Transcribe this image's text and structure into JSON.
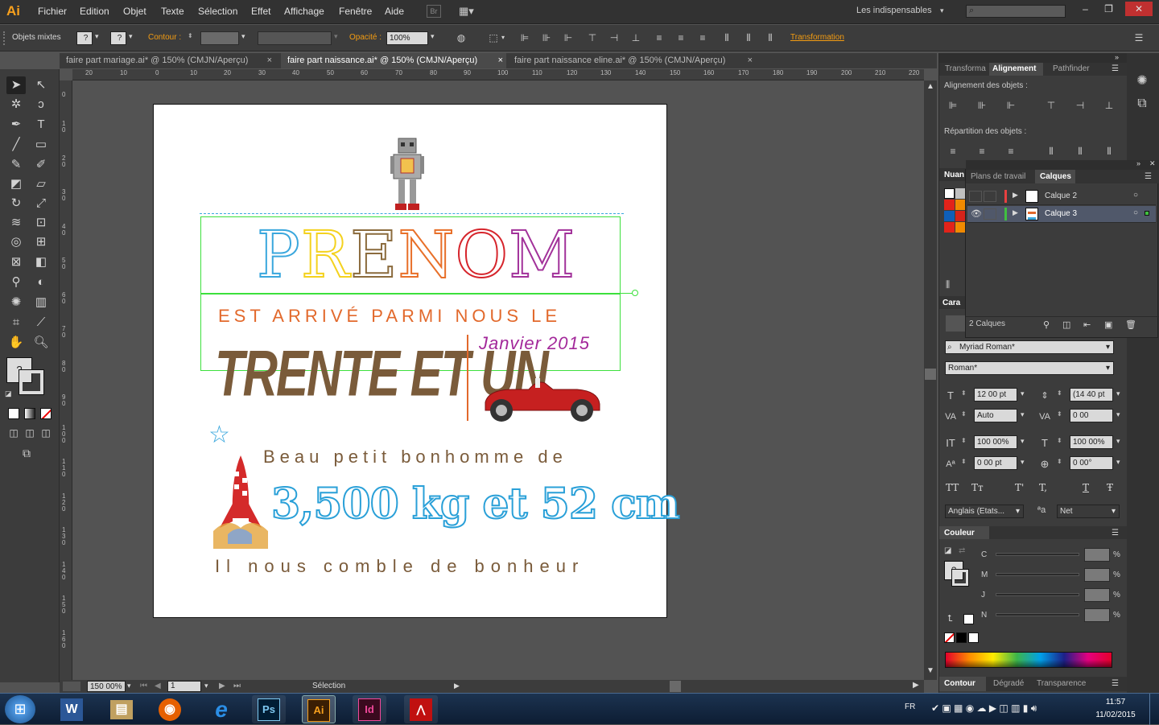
{
  "app": {
    "logo": "Ai"
  },
  "menu": [
    "Fichier",
    "Edition",
    "Objet",
    "Texte",
    "Sélection",
    "Effet",
    "Affichage",
    "Fenêtre",
    "Aide"
  ],
  "menu_br": "Br",
  "workspace": "Les indispensables",
  "control": {
    "selection_label": "Objets mixtes",
    "contour_label": "Contour :",
    "opacity_label": "Opacité :",
    "opacity_value": "100%",
    "transform_label": "Transformation",
    "question_mark": "?"
  },
  "tabs": [
    {
      "label": "faire part mariage.ai* @ 150% (CMJN/Aperçu)"
    },
    {
      "label": "faire part naissance.ai* @ 150% (CMJN/Aperçu)"
    },
    {
      "label": "faire part naissance eline.ai* @ 150% (CMJN/Aperçu)"
    }
  ],
  "ruler_h": [
    "20",
    "10",
    "0",
    "10",
    "20",
    "30",
    "40",
    "50",
    "60",
    "70",
    "80",
    "90",
    "100",
    "110",
    "120",
    "130",
    "140",
    "150",
    "160",
    "170",
    "180",
    "190",
    "200",
    "210",
    "220"
  ],
  "ruler_v": [
    "0",
    "1\n0",
    "2\n0",
    "3\n0",
    "4\n0",
    "5\n0",
    "6\n0",
    "7\n0",
    "8\n0",
    "9\n0",
    "1\n0\n0",
    "1\n1\n0",
    "1\n2\n0",
    "1\n3\n0",
    "1\n4\n0",
    "1\n5\n0",
    "1\n6\n0"
  ],
  "artboard": {
    "prenom": [
      "P",
      "R",
      "E",
      "N",
      "O",
      "M"
    ],
    "prenom_colors": [
      "#3aa7dd",
      "#d43f8d",
      "#f4d21f",
      "#8b6b3d",
      "#e8702a",
      "#d6252c",
      "#a2329a"
    ],
    "arrive": "EST ARRIVÉ PARMI NOUS LE",
    "date_big": "TRENTE ET UN",
    "date_small": "Janvier 2015",
    "beau": "Beau petit bonhomme de",
    "poids": "3,500 kg et 52 cm",
    "comble": "Il nous comble de bonheur",
    "star": "☆"
  },
  "status": {
    "zoom": "150 00%",
    "page": "1",
    "tool": "Sélection"
  },
  "panels": {
    "top_tabs": [
      "Transforma",
      "Alignement",
      "Pathfinder"
    ],
    "align_label": "Alignement des objets :",
    "distrib_label": "Répartition des objets :",
    "nuances_tab": "Nuan",
    "layer_tabs": [
      "Plans de travail",
      "Calques"
    ],
    "layers": [
      {
        "name": "Calque 2",
        "color": "#e84040"
      },
      {
        "name": "Calque 3",
        "color": "#40c040"
      }
    ],
    "layer_count": "2 Calques",
    "cara_tab": "Cara",
    "font_name": "Myriad Roman*",
    "font_style": "Roman*",
    "size": "12 00 pt",
    "leading": "(14 40 pt",
    "kerning": "Auto",
    "tracking": "0 00",
    "vscale": "100 00%",
    "hscale": "100 00%",
    "baseline": "0 00 pt",
    "rotation": "0 00°",
    "lang": "Anglais (Etats...",
    "antialias": "Net",
    "type_buttons": [
      "TT",
      "Tт",
      "T'",
      "T,",
      "T",
      "Ŧ"
    ],
    "couleur_tab": "Couleur",
    "cmyk": [
      {
        "ch": "C"
      },
      {
        "ch": "M"
      },
      {
        "ch": "J"
      },
      {
        "ch": "N"
      }
    ],
    "percent": "%",
    "bottom_tabs": [
      "Contour",
      "Dégradé",
      "Transparence"
    ]
  },
  "taskbar": {
    "apps": [
      {
        "label": "W",
        "color": "#2b5797"
      },
      {
        "label": "▤",
        "color": "#c0a060"
      },
      {
        "label": "◉",
        "color": "#e66000"
      },
      {
        "label": "e",
        "color": "#2b8ee6"
      },
      {
        "label": "Ps",
        "color": "#001d34"
      },
      {
        "label": "Ai",
        "color": "#3a1e04"
      },
      {
        "label": "Id",
        "color": "#3a0a1e"
      },
      {
        "label": "⋀",
        "color": "#c01010"
      }
    ],
    "lang": "FR",
    "time": "11:57",
    "date": "11/02/2015"
  }
}
